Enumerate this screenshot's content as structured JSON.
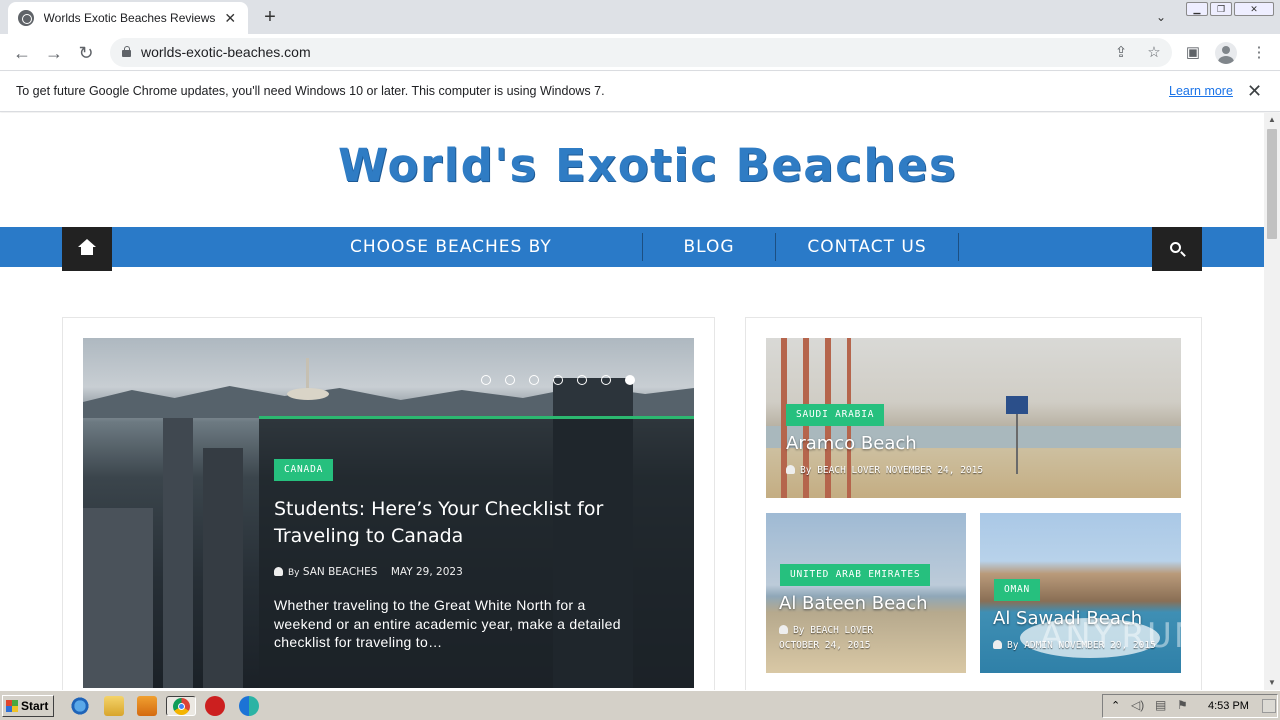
{
  "browser": {
    "tab_title": "Worlds Exotic Beaches Reviews, Tra",
    "tab_close": "✕",
    "new_tab": "+",
    "url": "worlds-exotic-beaches.com",
    "icons": [
      "back-arrow-icon",
      "forward-arrow-icon",
      "reload-icon",
      "lock-icon",
      "share-icon",
      "bookmark-star-icon",
      "side-panel-icon",
      "profile-icon",
      "menu-kebab-icon"
    ]
  },
  "infobar": {
    "message": "To get future Google Chrome updates, you'll need Windows 10 or later. This computer is using Windows 7.",
    "link": "Learn more",
    "close": "✕"
  },
  "site": {
    "logo": "World's Exotic Beaches",
    "nav": {
      "items": [
        {
          "label": "CHOOSE BEACHES BY CONTINENTS"
        },
        {
          "label": "BLOG"
        },
        {
          "label": "CONTACT US"
        }
      ]
    },
    "featured": {
      "category": "CANADA",
      "title": "Students: Here’s Your Checklist for Traveling to Canada",
      "by": "By",
      "author": "SAN BEACHES",
      "date": "MAY 29, 2023",
      "excerpt": "Whether traveling to the Great White North for a weekend or an entire academic year, make a detailed checklist for traveling to…",
      "slide_count": 7,
      "active_slide": 7
    },
    "side_posts": [
      {
        "category": "SAUDI ARABIA",
        "title": "Aramco Beach",
        "by": "By",
        "author": "BEACH LOVER",
        "date": "NOVEMBER 24, 2015"
      },
      {
        "category": "UNITED ARAB EMIRATES",
        "title": "Al Bateen Beach",
        "by": "By",
        "author": "BEACH LOVER",
        "date": "OCTOBER 24, 2015"
      },
      {
        "category": "OMAN",
        "title": "Al Sawadi Beach",
        "by": "By",
        "author": "ADMIN",
        "date": "NOVEMBER 20, 2015"
      }
    ]
  },
  "watermark": "ANY.RUN",
  "taskbar": {
    "start_label": "Start",
    "clock": "4:53 PM"
  },
  "colors": {
    "nav_bar": "#2a7ac8",
    "accent_green": "#26c07e",
    "logo_blue": "#2f7cc4"
  }
}
